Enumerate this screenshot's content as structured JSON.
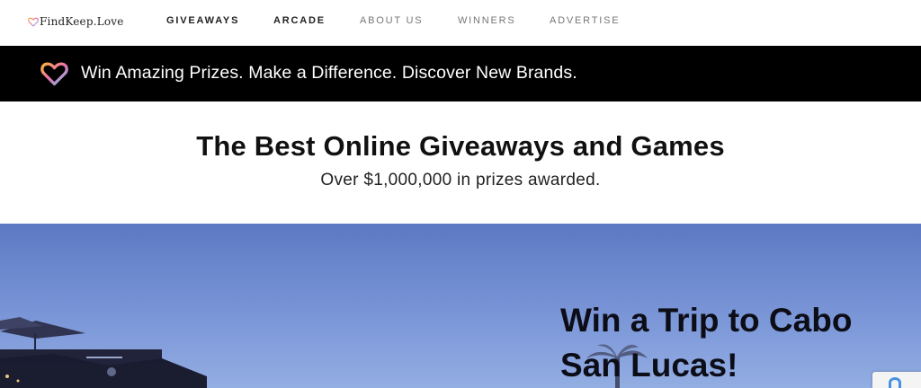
{
  "nav": {
    "logo_text": "FindKeep.Love",
    "links": [
      {
        "label": "GIVEAWAYS"
      },
      {
        "label": "ARCADE"
      },
      {
        "label": "ABOUT US"
      },
      {
        "label": "WINNERS"
      },
      {
        "label": "ADVERTISE"
      }
    ]
  },
  "banner": {
    "text": "Win Amazing Prizes. Make a Difference. Discover New Brands."
  },
  "headline": {
    "title": "The Best Online Giveaways and Games",
    "subtitle": "Over $1,000,000 in prizes awarded."
  },
  "hero": {
    "title_line1": "Win a Trip to Cabo",
    "title_line2": "San Lucas!"
  },
  "colors": {
    "banner_bg": "#000000",
    "hero_sky": "#7592d6",
    "heart_gradient": [
      "#f6b33c",
      "#ee6fb0",
      "#6cc5ee"
    ]
  },
  "icons": [
    "heart-logo-icon",
    "heart-banner-icon",
    "recaptcha-icon"
  ]
}
